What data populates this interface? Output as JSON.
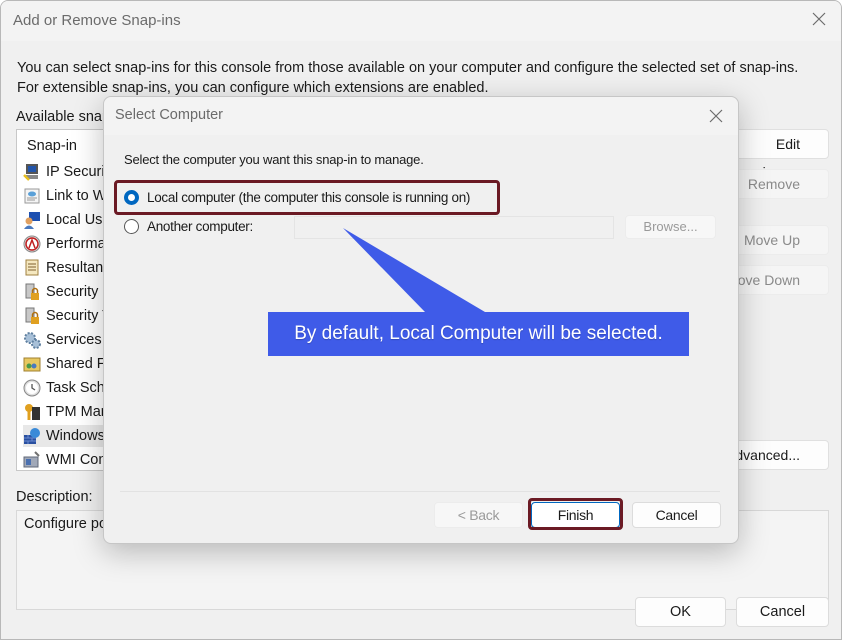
{
  "main_dialog": {
    "title": "Add or Remove Snap-ins",
    "intro_line1": "You can select snap-ins for this console from those available on your computer and configure the selected set of snap-ins.",
    "intro_line2": "For extensible snap-ins, you can configure which extensions are enabled.",
    "available_label": "Available snap-ins:",
    "list_header": "Snap-in",
    "snapins": [
      {
        "label": "IP Security Monitor",
        "icon": "ip-security-icon"
      },
      {
        "label": "Link to Web Address",
        "icon": "link-web-icon"
      },
      {
        "label": "Local Users and Groups",
        "icon": "local-users-icon"
      },
      {
        "label": "Performance Monitor",
        "icon": "performance-icon"
      },
      {
        "label": "Resultant Set of Policy",
        "icon": "resultant-policy-icon"
      },
      {
        "label": "Security Configuration",
        "icon": "security-config-icon"
      },
      {
        "label": "Security Templates",
        "icon": "security-templates-icon"
      },
      {
        "label": "Services",
        "icon": "services-icon"
      },
      {
        "label": "Shared Folders",
        "icon": "shared-folders-icon"
      },
      {
        "label": "Task Scheduler",
        "icon": "task-scheduler-icon"
      },
      {
        "label": "TPM Management",
        "icon": "tpm-icon"
      },
      {
        "label": "Windows Defender Firewall",
        "icon": "firewall-icon"
      },
      {
        "label": "WMI Control",
        "icon": "wmi-icon"
      }
    ],
    "side_buttons": {
      "edit_extensions": "Edit Extensions...",
      "remove": "Remove",
      "move_up": "Move Up",
      "move_down": "Move Down",
      "advanced": "Advanced..."
    },
    "description_label": "Description:",
    "description_text": "Configure policies",
    "ok": "OK",
    "cancel": "Cancel"
  },
  "select_computer": {
    "title": "Select Computer",
    "prompt": "Select the computer you want this snap-in to manage.",
    "option_local": "Local computer (the computer this console is running on)",
    "option_another": "Another computer:",
    "another_value": "",
    "selected": "local",
    "browse": "Browse...",
    "back": "< Back",
    "finish": "Finish",
    "cancel": "Cancel"
  },
  "annotation": {
    "callout_text": "By default, Local Computer will be selected.",
    "callout_color": "#3f5be8",
    "highlight_color": "#6b1a24"
  },
  "colors": {
    "accent": "#0067c0",
    "dialog_bg": "#f0f0f0"
  }
}
